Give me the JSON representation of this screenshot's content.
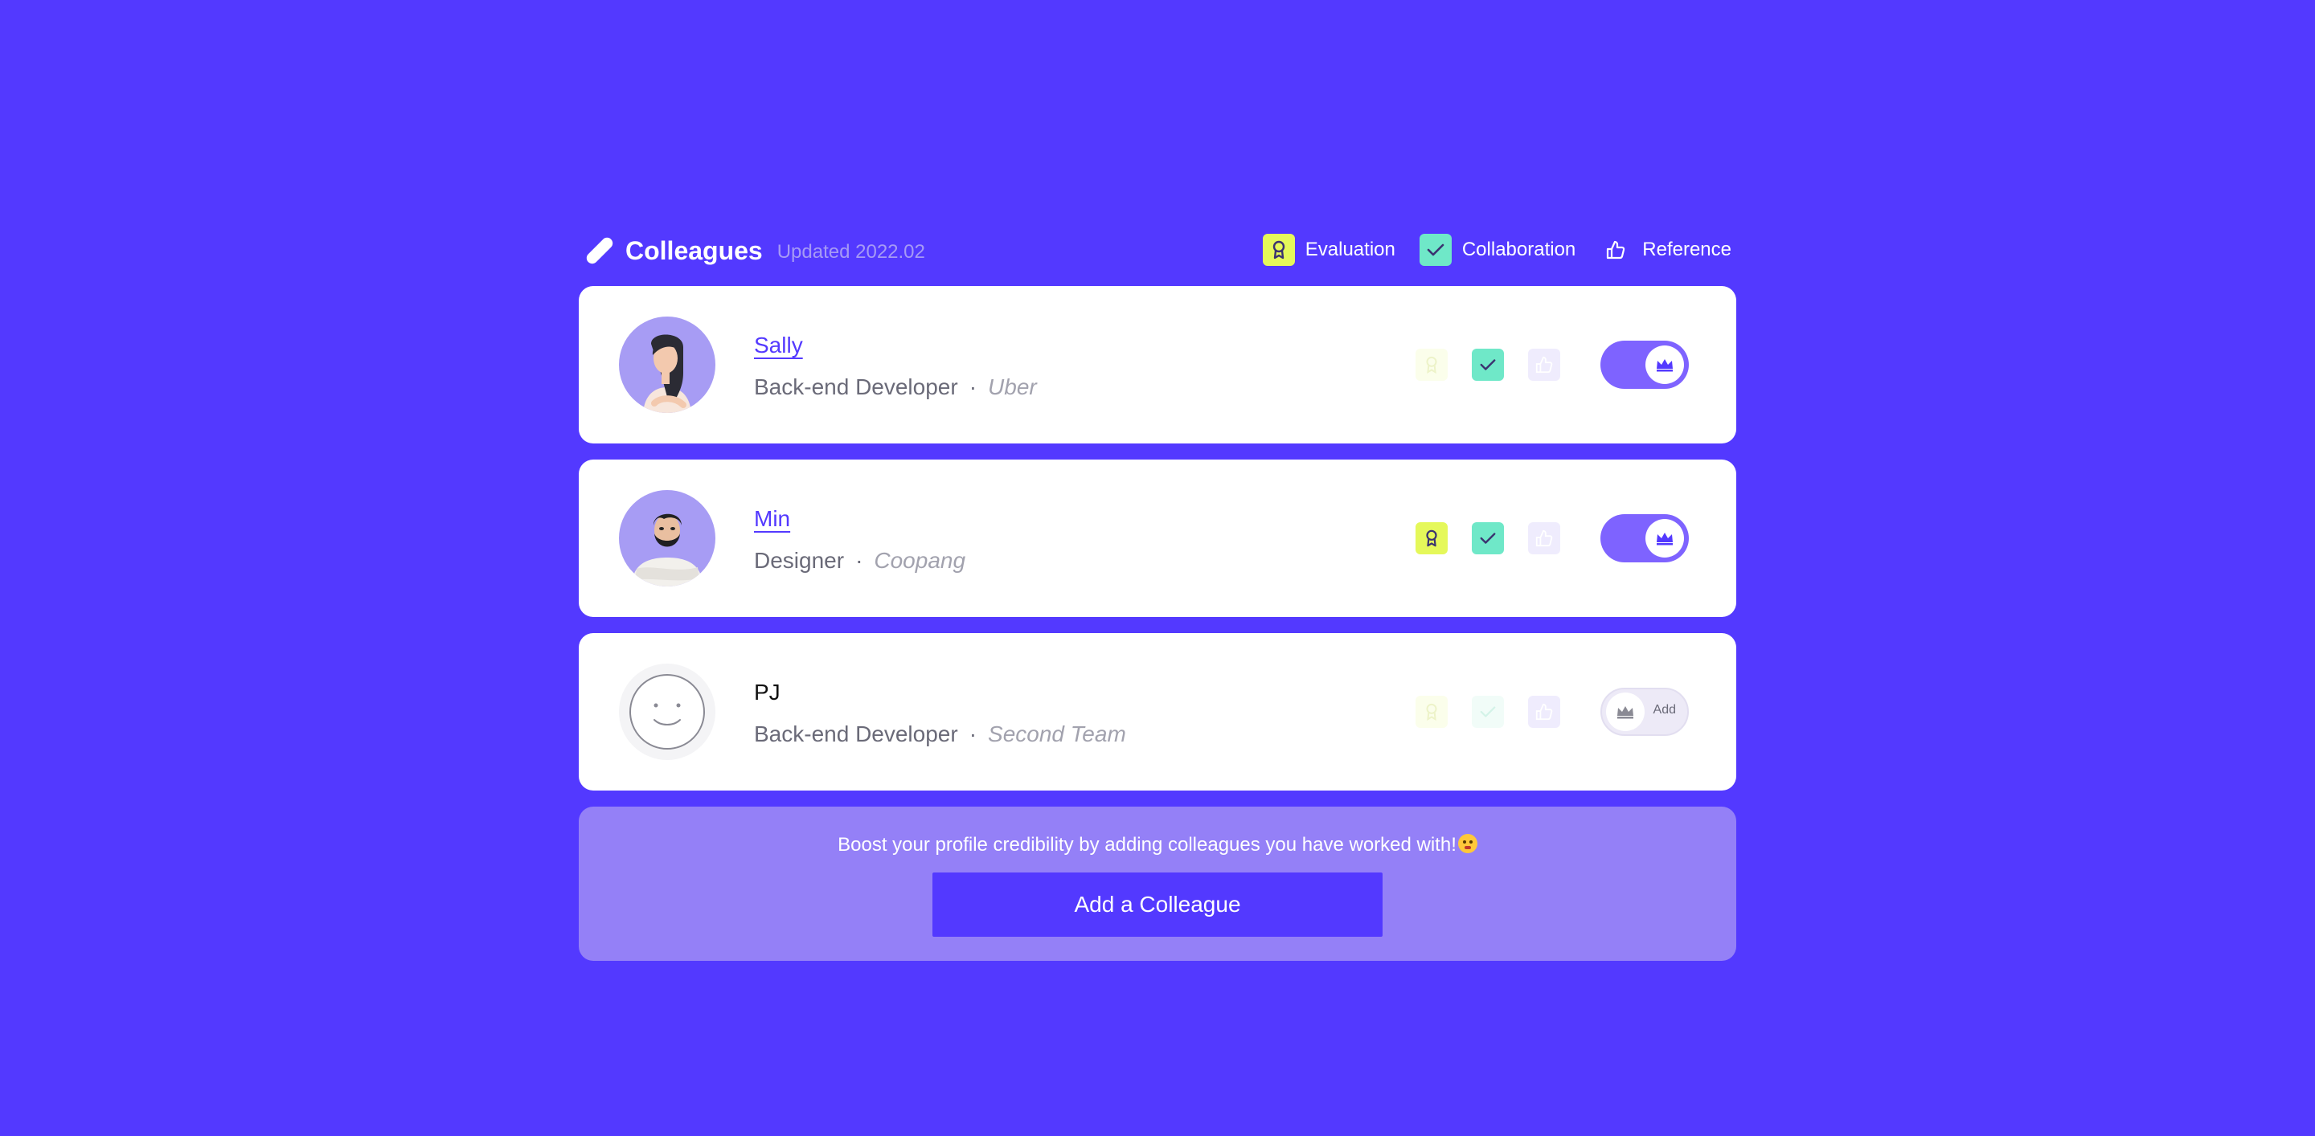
{
  "header": {
    "title": "Colleagues",
    "updated": "Updated 2022.02",
    "legend": [
      {
        "label": "Evaluation",
        "icon": "ribbon-icon",
        "color": "#E5F85A"
      },
      {
        "label": "Collaboration",
        "icon": "check-icon",
        "color": "#6FE8C8"
      },
      {
        "label": "Reference",
        "icon": "thumbs-up-icon",
        "color": "#FFFFFF"
      }
    ]
  },
  "colleagues": [
    {
      "name": "Sally",
      "role": "Back-end Developer",
      "separator": "·",
      "company": "Uber",
      "avatar": "avatar-woman",
      "evaluation": false,
      "collaboration": true,
      "reference": false,
      "crown": true
    },
    {
      "name": "Min",
      "role": "Designer",
      "separator": "·",
      "company": "Coopang",
      "avatar": "avatar-man-beard",
      "evaluation": true,
      "collaboration": true,
      "reference": false,
      "crown": true
    },
    {
      "name": "PJ",
      "role": "Back-end Developer",
      "separator": "·",
      "company": "Second Team",
      "avatar": "smiley-placeholder",
      "evaluation": false,
      "collaboration": false,
      "reference": false,
      "crown": false,
      "toggle_label": "Add"
    }
  ],
  "cta": {
    "message": "Boost your profile credibility by adding colleagues you have worked with!",
    "button_label": "Add a Colleague"
  },
  "colors": {
    "background": "#5339FF",
    "accent": "#7E63FF",
    "evaluation": "#E5F85A",
    "collaboration": "#6FE8C8",
    "reference_off": "#EFECFD"
  }
}
